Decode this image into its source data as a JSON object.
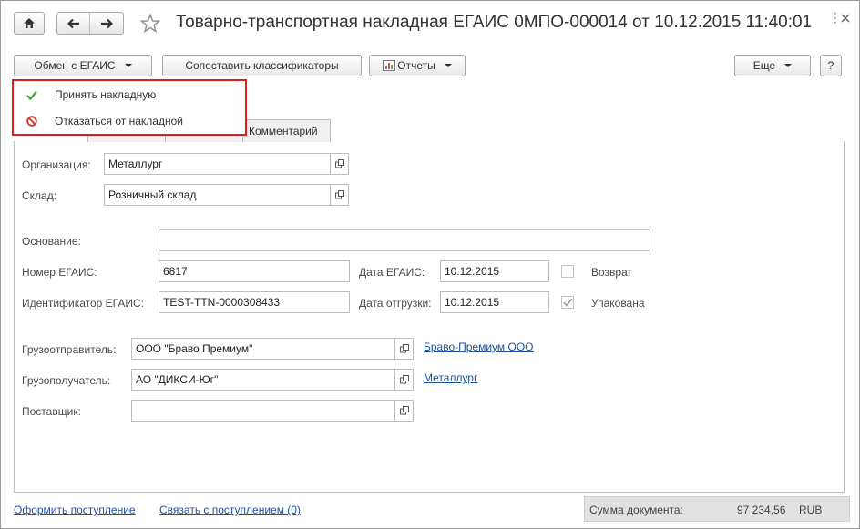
{
  "window": {
    "title": "Товарно-транспортная накладная ЕГАИС 0МПО-000014 от 10.12.2015 11:40:01"
  },
  "toolbar": {
    "exchange_label": "Обмен с ЕГАИС",
    "match_label": "Сопоставить классификаторы",
    "reports_label": "Отчеты",
    "more_label": "Еще",
    "help_label": "?"
  },
  "menu": {
    "items": [
      {
        "label": "Принять накладную",
        "icon": "check-icon"
      },
      {
        "label": "Отказаться от накладной",
        "icon": "forbidden-icon"
      }
    ]
  },
  "tabs": {
    "comment": "Комментарий"
  },
  "form": {
    "organization_label": "Организация:",
    "organization_value": "Металлург",
    "warehouse_label": "Склад:",
    "warehouse_value": "Розничный склад",
    "basis_label": "Основание:",
    "basis_value": "",
    "egais_number_label": "Номер ЕГАИС:",
    "egais_number_value": "6817",
    "egais_date_label": "Дата ЕГАИС:",
    "egais_date_value": "10.12.2015",
    "return_label": "Возврат",
    "return_checked": false,
    "egais_id_label": "Идентификатор ЕГАИС:",
    "egais_id_value": "TEST-TTN-0000308433",
    "ship_date_label": "Дата отгрузки:",
    "ship_date_value": "10.12.2015",
    "packed_label": "Упакована",
    "packed_checked": true,
    "shipper_label": "Грузоотправитель:",
    "shipper_value": "ООО \"Браво Премиум\"",
    "shipper_link": "Браво-Премиум ООО",
    "consignee_label": "Грузополучатель:",
    "consignee_value": "АО \"ДИКСИ-Юг\"",
    "consignee_link": "Металлург",
    "supplier_label": "Поставщик:",
    "supplier_value": ""
  },
  "footer": {
    "create_receipt_link": "Оформить поступление",
    "link_receipt_link": "Связать с поступлением (0)",
    "sum_label": "Сумма документа:",
    "sum_value": "97 234,56",
    "currency": "RUB"
  },
  "colors": {
    "highlight_border": "#e01b1b",
    "link": "#1f4f9e",
    "check_green": "#3aa52c",
    "forbidden_red": "#d8322a"
  }
}
